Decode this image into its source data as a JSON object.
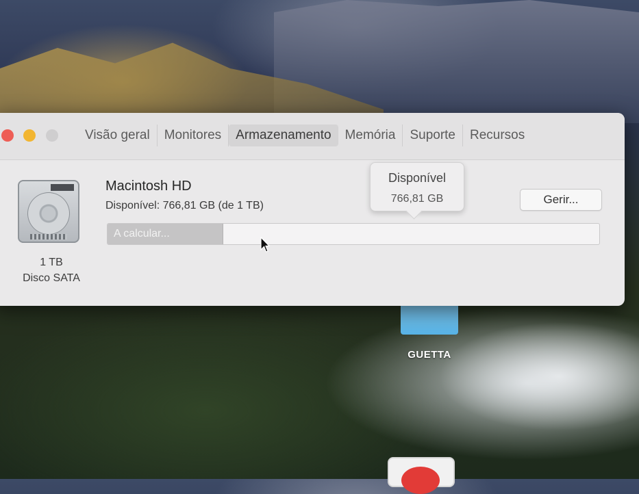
{
  "window": {
    "tabs": [
      {
        "label": "Visão geral",
        "active": false
      },
      {
        "label": "Monitores",
        "active": false
      },
      {
        "label": "Armazenamento",
        "active": true
      },
      {
        "label": "Memória",
        "active": false
      },
      {
        "label": "Suporte",
        "active": false
      },
      {
        "label": "Recursos",
        "active": false
      }
    ]
  },
  "disk": {
    "icon": "hard-drive-icon",
    "size": "1 TB",
    "type": "Disco SATA"
  },
  "volume": {
    "name": "Macintosh HD",
    "available": "Disponível: 766,81 GB (de 1 TB)",
    "bar_label": "A calcular...",
    "used_fraction": 0.2334,
    "manage_label": "Gerir..."
  },
  "tooltip": {
    "title": "Disponível",
    "value": "766,81 GB"
  },
  "desktop": {
    "folder_label": "GUETTA",
    "folder_color": "#63bbea"
  },
  "colors": {
    "close": "#ee5d55",
    "minimize": "#f2b531",
    "zoom_disabled": "#cfcecf"
  }
}
